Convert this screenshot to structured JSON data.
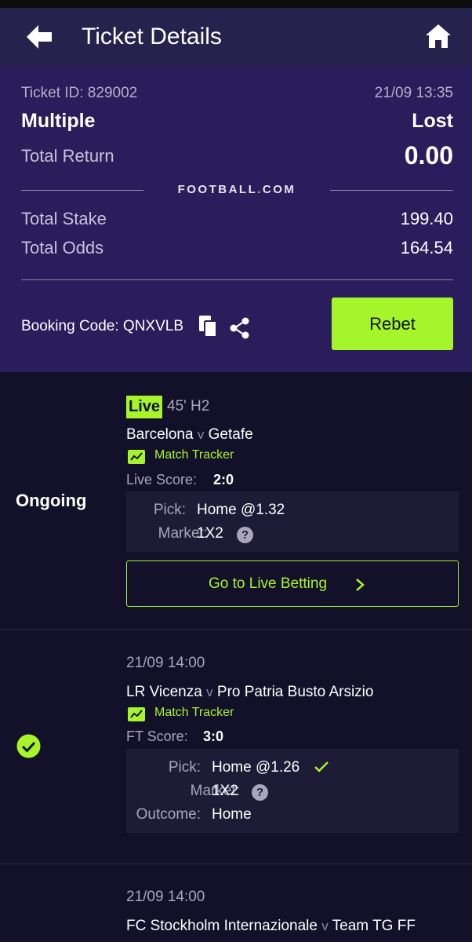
{
  "header": {
    "title": "Ticket Details"
  },
  "summary": {
    "ticket_id": "Ticket ID: 829002",
    "date": "21/09 13:35",
    "bet_type": "Multiple",
    "status": "Lost",
    "total_return_label": "Total Return",
    "total_return_value": "0.00",
    "brand_prefix": "FOOTBALL",
    "brand_dot": ".",
    "brand_suffix": "COM",
    "total_stake_label": "Total Stake",
    "total_stake_value": "199.40",
    "total_odds_label": "Total Odds",
    "total_odds_value": "164.54",
    "booking_code": "Booking Code: QNXVLB",
    "rebet_label": "Rebet"
  },
  "selections": [
    {
      "state": "Ongoing",
      "live_badge": "Live",
      "time": "45' H2",
      "home": "Barcelona",
      "vs": "v",
      "away": "Getafe",
      "tracker": "Match Tracker",
      "score_label": "Live Score:",
      "score": "2:0",
      "pick_label": "Pick:",
      "pick": "Home @1.32",
      "market_label": "Market:",
      "market": "1X2",
      "cta": "Go to Live Betting"
    },
    {
      "state": "won",
      "time": "21/09 14:00",
      "home": "LR Vicenza",
      "vs": "v",
      "away": "Pro Patria Busto Arsizio",
      "tracker": "Match Tracker",
      "score_label": "FT Score:",
      "score": "3:0",
      "pick_label": "Pick:",
      "pick": "Home @1.26",
      "market_label": "Market:",
      "market": "1X2",
      "outcome_label": "Outcome:",
      "outcome": "Home"
    },
    {
      "time": "21/09 14:00",
      "home": "FC Stockholm Internazionale",
      "vs": "v",
      "away": "Team TG FF"
    }
  ],
  "help_glyph": "?",
  "colors": {
    "accent": "#a6f52a",
    "header_bg": "#27214d",
    "summary_bg": "#2a1d5c",
    "page_bg": "#13102a"
  }
}
